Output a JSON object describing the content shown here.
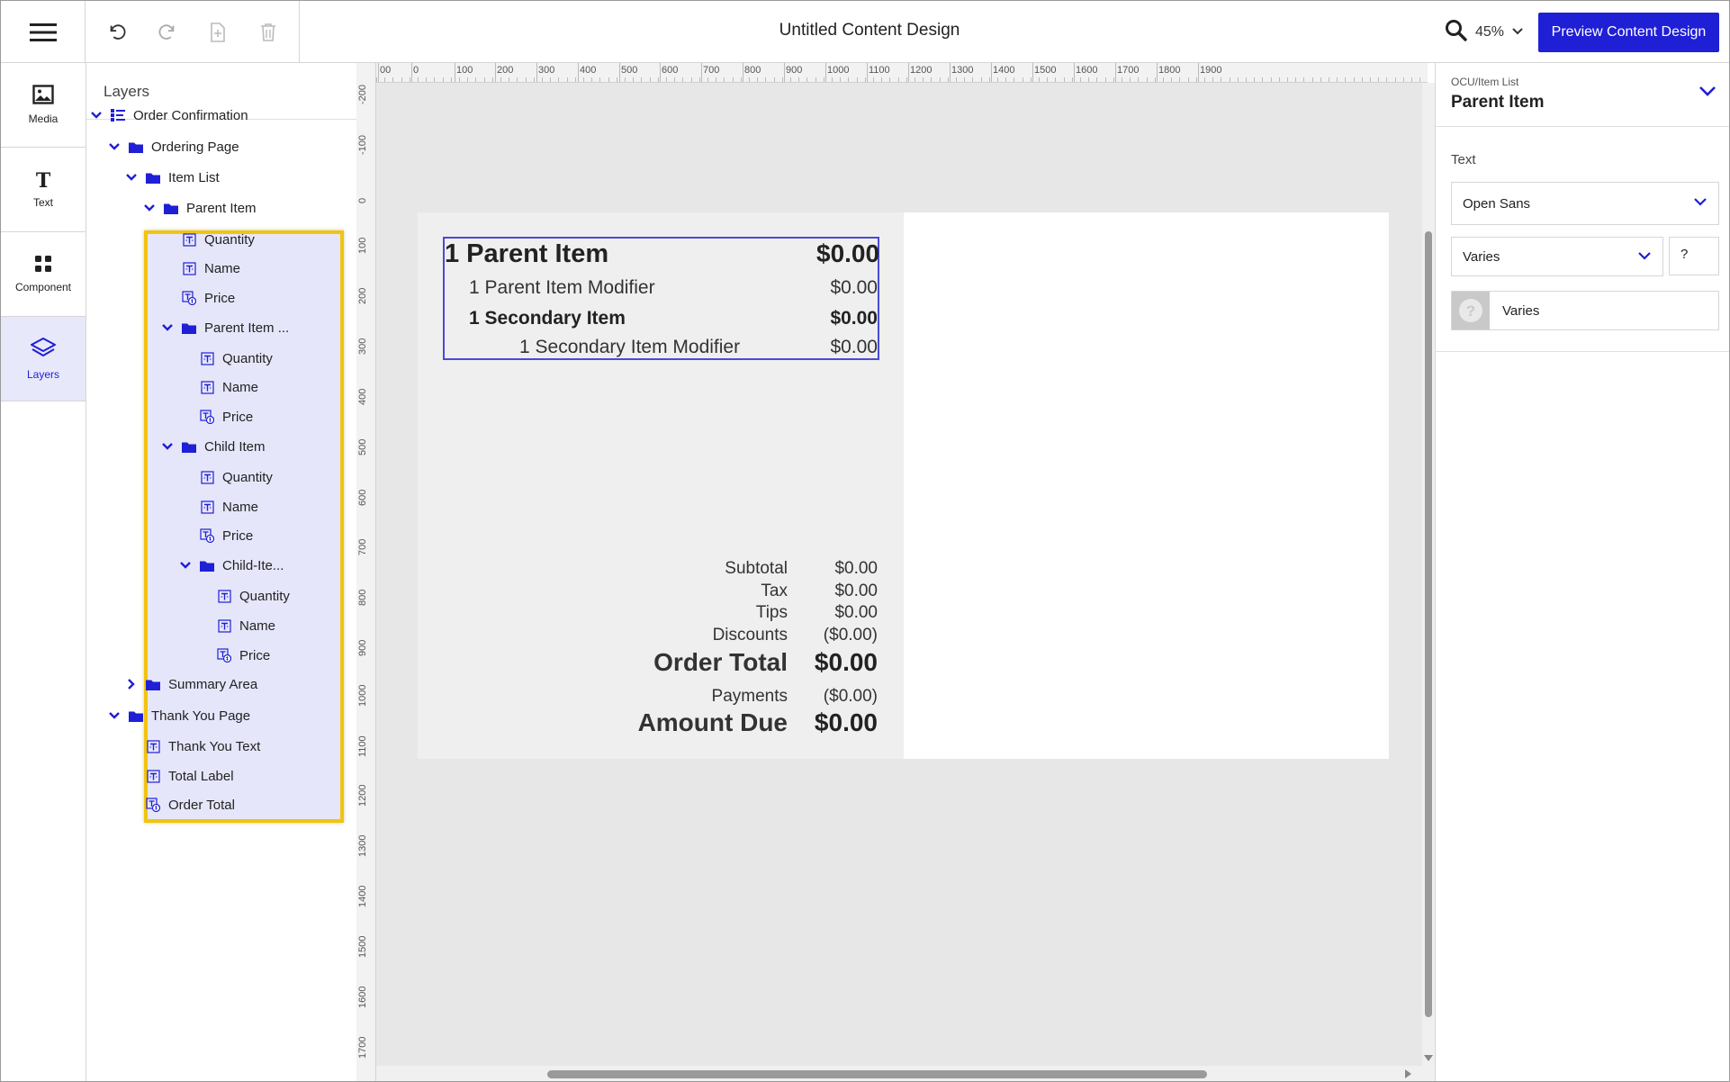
{
  "app": {
    "document_title": "Untitled Content Design",
    "zoom_level": "45%",
    "preview_button": "Preview Content Design"
  },
  "toolbar": {
    "undo_icon": "undo-icon",
    "redo_icon": "redo-icon",
    "add_page_icon": "add-page-icon",
    "delete_icon": "trash-icon"
  },
  "rail": {
    "items": [
      {
        "label": "Media",
        "icon": "image-icon"
      },
      {
        "label": "Text",
        "icon": "text-icon"
      },
      {
        "label": "Component",
        "icon": "grid-icon"
      },
      {
        "label": "Layers",
        "icon": "layers-icon"
      }
    ]
  },
  "layers": {
    "title": "Layers",
    "tree": [
      {
        "label": "Order Confirmation",
        "kind": "root",
        "expanded": true
      },
      {
        "label": "Ordering Page",
        "kind": "folder",
        "expanded": true
      },
      {
        "label": "Item List",
        "kind": "folder",
        "expanded": true
      },
      {
        "label": "Parent Item",
        "kind": "folder",
        "expanded": true
      },
      {
        "label": "Quantity",
        "kind": "text"
      },
      {
        "label": "Name",
        "kind": "text"
      },
      {
        "label": "Price",
        "kind": "price"
      },
      {
        "label": "Parent Item ...",
        "kind": "folder",
        "expanded": true
      },
      {
        "label": "Quantity",
        "kind": "text"
      },
      {
        "label": "Name",
        "kind": "text"
      },
      {
        "label": "Price",
        "kind": "price"
      },
      {
        "label": "Child Item",
        "kind": "folder",
        "expanded": true
      },
      {
        "label": "Quantity",
        "kind": "text"
      },
      {
        "label": "Name",
        "kind": "text"
      },
      {
        "label": "Price",
        "kind": "price"
      },
      {
        "label": "Child-Ite...",
        "kind": "folder",
        "expanded": true
      },
      {
        "label": "Quantity",
        "kind": "text"
      },
      {
        "label": "Name",
        "kind": "text"
      },
      {
        "label": "Price",
        "kind": "price"
      },
      {
        "label": "Summary Area",
        "kind": "folder",
        "expanded": false
      },
      {
        "label": "Thank You Page",
        "kind": "folder",
        "expanded": true
      },
      {
        "label": "Thank You Text",
        "kind": "text"
      },
      {
        "label": "Total Label",
        "kind": "text"
      },
      {
        "label": "Order Total",
        "kind": "price"
      }
    ]
  },
  "rulers": {
    "horizontal": [
      "00",
      "0",
      "100",
      "200",
      "300",
      "400",
      "500",
      "600",
      "700",
      "800",
      "900",
      "1000",
      "1100",
      "1200",
      "1300",
      "1400",
      "1500",
      "1600",
      "1700",
      "1800",
      "1900"
    ],
    "vertical": [
      "-200",
      "-100",
      "0",
      "100",
      "200",
      "300",
      "400",
      "500",
      "600",
      "700",
      "800",
      "900",
      "1000",
      "1100",
      "1200",
      "1300",
      "1400",
      "1500",
      "1600",
      "1700"
    ]
  },
  "receipt": {
    "parent_item": {
      "label": "1 Parent Item",
      "price": "$0.00"
    },
    "parent_modifier": {
      "label": "1 Parent Item Modifier",
      "price": "$0.00"
    },
    "secondary_item": {
      "label": "1 Secondary Item",
      "price": "$0.00"
    },
    "secondary_modifier": {
      "label": "1 Secondary Item Modifier",
      "price": "$0.00"
    },
    "subtotal": {
      "label": "Subtotal",
      "value": "$0.00"
    },
    "tax": {
      "label": "Tax",
      "value": "$0.00"
    },
    "tips": {
      "label": "Tips",
      "value": "$0.00"
    },
    "discounts": {
      "label": "Discounts",
      "value": "($0.00)"
    },
    "order_total": {
      "label": "Order Total",
      "value": "$0.00"
    },
    "payments": {
      "label": "Payments",
      "value": "($0.00)"
    },
    "amount_due": {
      "label": "Amount Due",
      "value": "$0.00"
    }
  },
  "properties": {
    "path": "OCU/Item List",
    "element_name": "Parent Item",
    "section_label": "Text",
    "font_family": "Open Sans",
    "font_weight": "Varies",
    "font_size": "?",
    "color_value": "Varies"
  },
  "colors": {
    "accent": "#1f1fd6",
    "highlight_border": "#f1c40f",
    "highlight_fill": "#e6e6fb"
  }
}
